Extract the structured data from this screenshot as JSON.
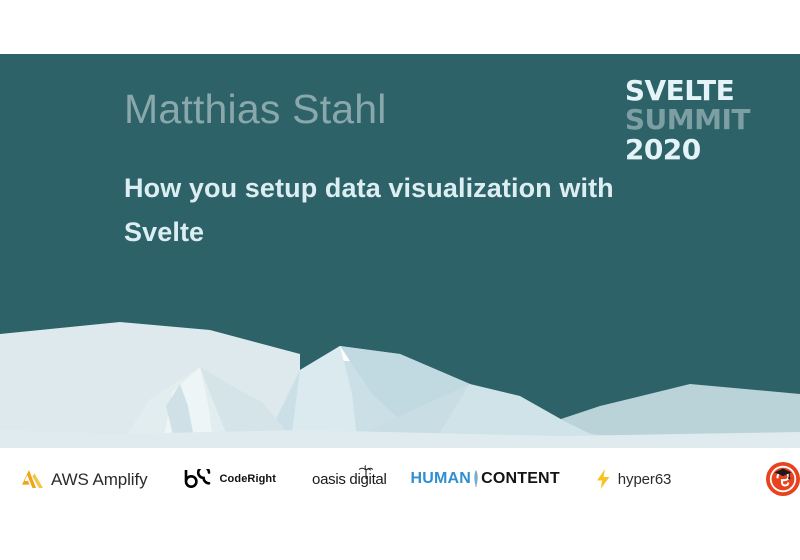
{
  "slide": {
    "background_color": "#2d6269",
    "speaker_name": "Matthias Stahl",
    "talk_title": "How you setup data visualization with Svelte"
  },
  "event_logo": {
    "line1": "SVELTE",
    "line2": "SUMMIT",
    "line3": "2020",
    "line1_color": "#e4f3f7",
    "line2_color": "#7d9ea2",
    "line3_color": "#e4f3f7"
  },
  "artwork": {
    "name": "snow-mountain-illustration",
    "sky_color": "#2d6269",
    "snow_light": "#e6eef0",
    "snow_mid": "#cfe2e7",
    "snow_dark": "#bcd4da",
    "snow_cap": "#ffffff",
    "figure_color": "#8a4a44"
  },
  "sponsors": [
    {
      "name": "aws-amplify",
      "label": "AWS Amplify",
      "icon": "amplify-triangle-icon",
      "icon_color": "#f2b705"
    },
    {
      "name": "coderight",
      "label": "CodeRight",
      "icon": "b6-mark-icon",
      "icon_color": "#000000"
    },
    {
      "name": "oasis-digital",
      "label": "oasis digital",
      "icon": "palm-tree-icon",
      "icon_color": "#1a1a1a"
    },
    {
      "name": "human-content",
      "label_a": "HUMAN",
      "label_b": "CONTENT",
      "icon": "feather-icon",
      "icon_color": "#2f8fd0"
    },
    {
      "name": "hyper63",
      "label": "hyper63",
      "icon": "lightning-bolt-icon",
      "icon_color": "#f5c518"
    },
    {
      "name": "circle-badge",
      "label": "",
      "icon": "graduate-circle-icon",
      "icon_color": "#e8421f"
    }
  ]
}
